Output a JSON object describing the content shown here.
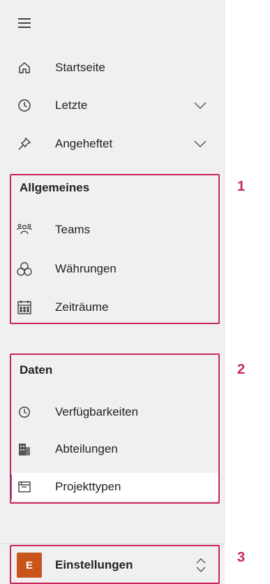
{
  "nav": {
    "menu_icon": "hamburger-icon",
    "items": [
      {
        "label": "Startseite",
        "icon": "home-icon"
      },
      {
        "label": "Letzte",
        "icon": "clock-icon",
        "expandable": true
      },
      {
        "label": "Angeheftet",
        "icon": "pin-icon",
        "expandable": true
      }
    ]
  },
  "sections": [
    {
      "title": "Allgemeines",
      "number": "1",
      "items": [
        {
          "label": "Teams",
          "icon": "team-icon"
        },
        {
          "label": "Währungen",
          "icon": "currency-icon"
        },
        {
          "label": "Zeiträume",
          "icon": "calendar-icon"
        }
      ]
    },
    {
      "title": "Daten",
      "number": "2",
      "items": [
        {
          "label": "Verfügbarkeiten",
          "icon": "clock-icon"
        },
        {
          "label": "Abteilungen",
          "icon": "building-icon"
        },
        {
          "label": "Projekttypen",
          "icon": "project-type-icon",
          "selected": true
        }
      ]
    }
  ],
  "footer": {
    "avatar_letter": "E",
    "label": "Einstellungen",
    "number": "3"
  },
  "colors": {
    "highlight": "#c8255c",
    "selected_bar": "#5b5fc7",
    "avatar": "#c8561a"
  }
}
